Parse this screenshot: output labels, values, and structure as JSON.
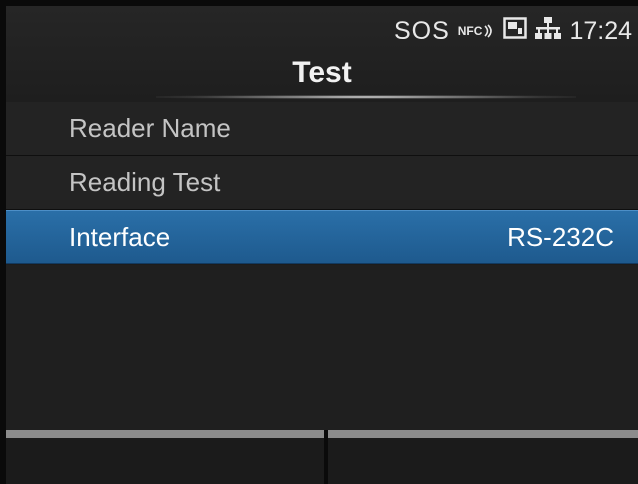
{
  "status": {
    "sos": "SOS",
    "nfc": "NFC",
    "time": "17:24",
    "icons": [
      "nfc-icon",
      "sd-card-icon",
      "network-icon"
    ]
  },
  "title": "Test",
  "menu": {
    "items": [
      {
        "label": "Reader Name",
        "value": "",
        "selected": false
      },
      {
        "label": "Reading Test",
        "value": "",
        "selected": false
      },
      {
        "label": "Interface",
        "value": "RS-232C",
        "selected": true
      }
    ]
  },
  "softkeys": {
    "left": "",
    "right": ""
  },
  "colors": {
    "selection": "#2a6fa8",
    "background": "#1c1c1c",
    "text": "#c4c4c4"
  }
}
